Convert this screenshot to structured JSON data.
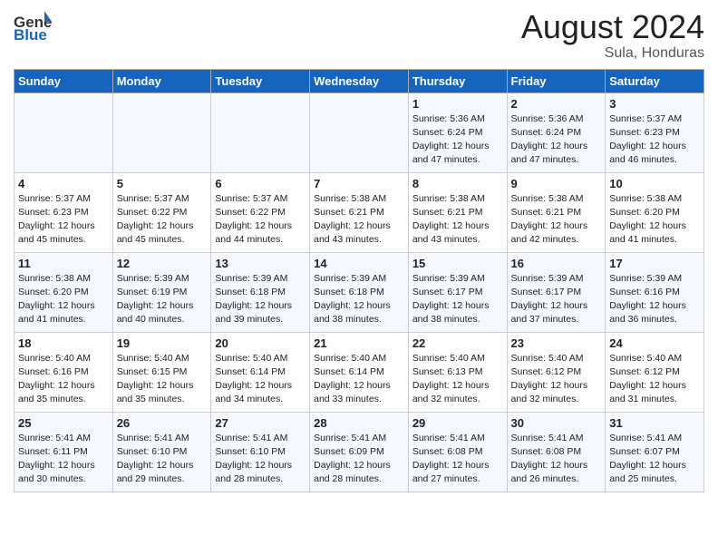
{
  "header": {
    "logo_general": "General",
    "logo_blue": "Blue",
    "month_year": "August 2024",
    "location": "Sula, Honduras"
  },
  "days_of_week": [
    "Sunday",
    "Monday",
    "Tuesday",
    "Wednesday",
    "Thursday",
    "Friday",
    "Saturday"
  ],
  "weeks": [
    [
      {
        "day": "",
        "info": ""
      },
      {
        "day": "",
        "info": ""
      },
      {
        "day": "",
        "info": ""
      },
      {
        "day": "",
        "info": ""
      },
      {
        "day": "1",
        "info": "Sunrise: 5:36 AM\nSunset: 6:24 PM\nDaylight: 12 hours\nand 47 minutes."
      },
      {
        "day": "2",
        "info": "Sunrise: 5:36 AM\nSunset: 6:24 PM\nDaylight: 12 hours\nand 47 minutes."
      },
      {
        "day": "3",
        "info": "Sunrise: 5:37 AM\nSunset: 6:23 PM\nDaylight: 12 hours\nand 46 minutes."
      }
    ],
    [
      {
        "day": "4",
        "info": "Sunrise: 5:37 AM\nSunset: 6:23 PM\nDaylight: 12 hours\nand 45 minutes."
      },
      {
        "day": "5",
        "info": "Sunrise: 5:37 AM\nSunset: 6:22 PM\nDaylight: 12 hours\nand 45 minutes."
      },
      {
        "day": "6",
        "info": "Sunrise: 5:37 AM\nSunset: 6:22 PM\nDaylight: 12 hours\nand 44 minutes."
      },
      {
        "day": "7",
        "info": "Sunrise: 5:38 AM\nSunset: 6:21 PM\nDaylight: 12 hours\nand 43 minutes."
      },
      {
        "day": "8",
        "info": "Sunrise: 5:38 AM\nSunset: 6:21 PM\nDaylight: 12 hours\nand 43 minutes."
      },
      {
        "day": "9",
        "info": "Sunrise: 5:38 AM\nSunset: 6:21 PM\nDaylight: 12 hours\nand 42 minutes."
      },
      {
        "day": "10",
        "info": "Sunrise: 5:38 AM\nSunset: 6:20 PM\nDaylight: 12 hours\nand 41 minutes."
      }
    ],
    [
      {
        "day": "11",
        "info": "Sunrise: 5:38 AM\nSunset: 6:20 PM\nDaylight: 12 hours\nand 41 minutes."
      },
      {
        "day": "12",
        "info": "Sunrise: 5:39 AM\nSunset: 6:19 PM\nDaylight: 12 hours\nand 40 minutes."
      },
      {
        "day": "13",
        "info": "Sunrise: 5:39 AM\nSunset: 6:18 PM\nDaylight: 12 hours\nand 39 minutes."
      },
      {
        "day": "14",
        "info": "Sunrise: 5:39 AM\nSunset: 6:18 PM\nDaylight: 12 hours\nand 38 minutes."
      },
      {
        "day": "15",
        "info": "Sunrise: 5:39 AM\nSunset: 6:17 PM\nDaylight: 12 hours\nand 38 minutes."
      },
      {
        "day": "16",
        "info": "Sunrise: 5:39 AM\nSunset: 6:17 PM\nDaylight: 12 hours\nand 37 minutes."
      },
      {
        "day": "17",
        "info": "Sunrise: 5:39 AM\nSunset: 6:16 PM\nDaylight: 12 hours\nand 36 minutes."
      }
    ],
    [
      {
        "day": "18",
        "info": "Sunrise: 5:40 AM\nSunset: 6:16 PM\nDaylight: 12 hours\nand 35 minutes."
      },
      {
        "day": "19",
        "info": "Sunrise: 5:40 AM\nSunset: 6:15 PM\nDaylight: 12 hours\nand 35 minutes."
      },
      {
        "day": "20",
        "info": "Sunrise: 5:40 AM\nSunset: 6:14 PM\nDaylight: 12 hours\nand 34 minutes."
      },
      {
        "day": "21",
        "info": "Sunrise: 5:40 AM\nSunset: 6:14 PM\nDaylight: 12 hours\nand 33 minutes."
      },
      {
        "day": "22",
        "info": "Sunrise: 5:40 AM\nSunset: 6:13 PM\nDaylight: 12 hours\nand 32 minutes."
      },
      {
        "day": "23",
        "info": "Sunrise: 5:40 AM\nSunset: 6:12 PM\nDaylight: 12 hours\nand 32 minutes."
      },
      {
        "day": "24",
        "info": "Sunrise: 5:40 AM\nSunset: 6:12 PM\nDaylight: 12 hours\nand 31 minutes."
      }
    ],
    [
      {
        "day": "25",
        "info": "Sunrise: 5:41 AM\nSunset: 6:11 PM\nDaylight: 12 hours\nand 30 minutes."
      },
      {
        "day": "26",
        "info": "Sunrise: 5:41 AM\nSunset: 6:10 PM\nDaylight: 12 hours\nand 29 minutes."
      },
      {
        "day": "27",
        "info": "Sunrise: 5:41 AM\nSunset: 6:10 PM\nDaylight: 12 hours\nand 28 minutes."
      },
      {
        "day": "28",
        "info": "Sunrise: 5:41 AM\nSunset: 6:09 PM\nDaylight: 12 hours\nand 28 minutes."
      },
      {
        "day": "29",
        "info": "Sunrise: 5:41 AM\nSunset: 6:08 PM\nDaylight: 12 hours\nand 27 minutes."
      },
      {
        "day": "30",
        "info": "Sunrise: 5:41 AM\nSunset: 6:08 PM\nDaylight: 12 hours\nand 26 minutes."
      },
      {
        "day": "31",
        "info": "Sunrise: 5:41 AM\nSunset: 6:07 PM\nDaylight: 12 hours\nand 25 minutes."
      }
    ]
  ]
}
